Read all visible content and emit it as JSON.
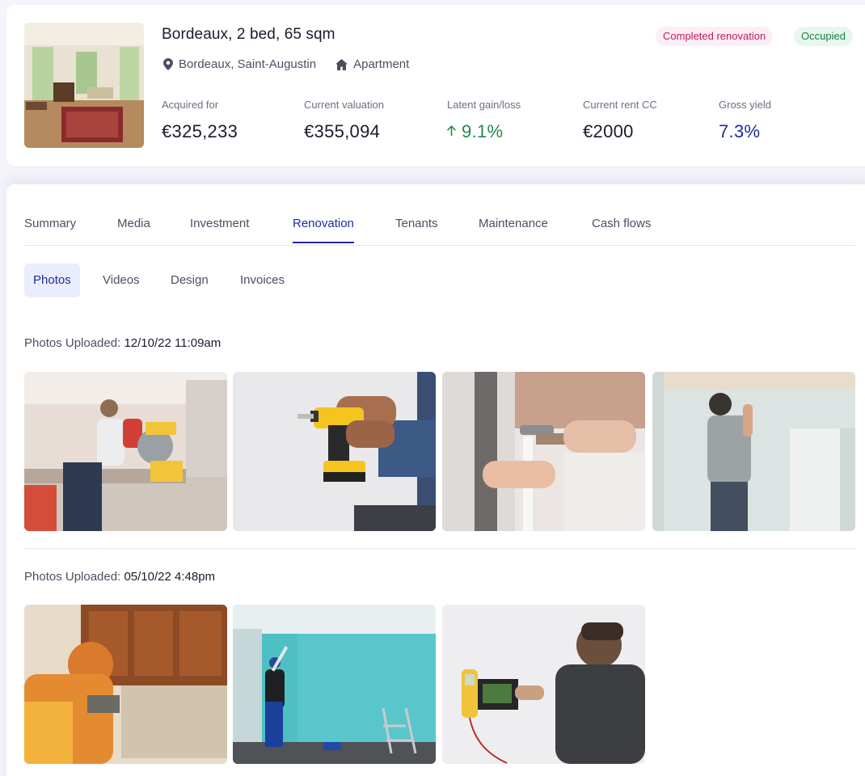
{
  "property": {
    "title": "Bordeaux, 2 bed, 65 sqm",
    "location": "Bordeaux, Saint-Augustin",
    "type": "Apartment",
    "badges": {
      "renovation": "Completed renovation",
      "occupancy": "Occupied"
    },
    "stats": {
      "acquired_label": "Acquired for",
      "acquired_value": "€325,233",
      "valuation_label": "Current valuation",
      "valuation_value": "€355,094",
      "gain_label": "Latent gain/loss",
      "gain_value": "9.1%",
      "rent_label": "Current rent CC",
      "rent_value": "€2000",
      "yield_label": "Gross yield",
      "yield_value": "7.3%"
    },
    "colors": {
      "gain": "#1f8a4c",
      "yield": "#1f2aa0",
      "accent": "#1f2aa0"
    }
  },
  "tabs": [
    "Summary",
    "Media",
    "Investment",
    "Renovation",
    "Tenants",
    "Maintenance",
    "Cash flows"
  ],
  "active_tab": "Renovation",
  "subtabs": [
    "Photos",
    "Videos",
    "Design",
    "Invoices"
  ],
  "active_subtab": "Photos",
  "photo_groups": [
    {
      "label": "Photos Uploaded:",
      "timestamp": "12/10/22 11:09am",
      "photos": [
        "miter-saw-cutting",
        "cordless-drill",
        "hammer-wall",
        "painting-ceiling"
      ]
    },
    {
      "label": "Photos Uploaded:",
      "timestamp": "05/10/22 4:48pm",
      "photos": [
        "kitchen-cabinet-install",
        "painting-blue-wall",
        "electrician-multimeter"
      ]
    }
  ],
  "icons": {
    "location": "map-pin-icon",
    "type": "house-icon",
    "gain": "arrow-up-icon"
  }
}
